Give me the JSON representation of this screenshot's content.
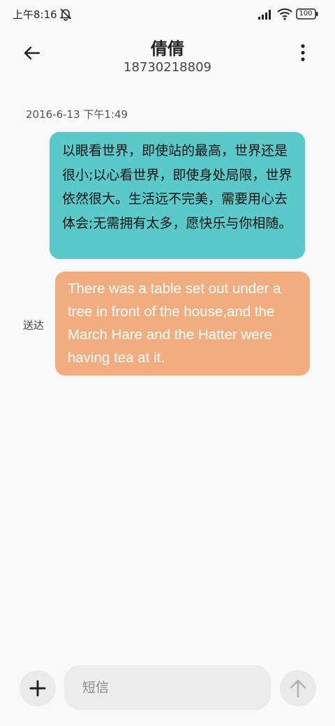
{
  "status_bar": {
    "time": "上午8:16",
    "battery_level": "100",
    "icons": [
      "mute-icon",
      "signal-icon",
      "wifi-icon",
      "battery-icon"
    ]
  },
  "header": {
    "contact_name": "倩倩",
    "phone_number": "18730218809",
    "icons": [
      "back-arrow-icon",
      "more-vertical-icon"
    ]
  },
  "conversation": {
    "timestamp": "2016-6-13 下午1:49",
    "messages": [
      {
        "direction": "incoming",
        "text": "以眼看世界，即使站的最高，世界还是很小;以心看世界，即使身处局限，世界依然很大。生活远不完美，需要用心去体会;无需拥有太多，愿快乐与你相随。",
        "bubble_color": "#5bc8c9"
      },
      {
        "direction": "outgoing",
        "text": "There was a table set out under a tree in front of the house,and the March Hare and the Hatter were having tea at it.",
        "status": "送达",
        "bubble_color": "#f1ad80"
      }
    ]
  },
  "composer": {
    "placeholder": "短信",
    "value": "",
    "icons": [
      "plus-icon",
      "send-arrow-icon"
    ]
  }
}
